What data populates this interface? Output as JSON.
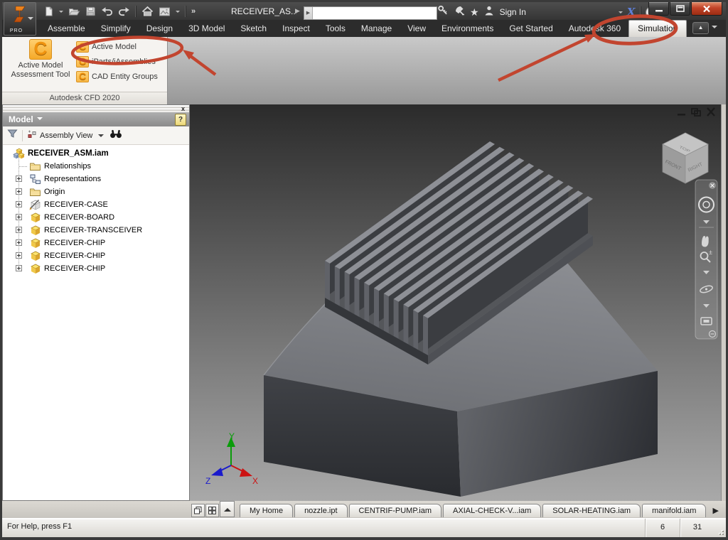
{
  "titlebar": {
    "app_badge": "PRO",
    "doc_title": "RECEIVER_AS...",
    "doc_arrow": "▶",
    "search_value": "",
    "sign_in_label": "Sign In",
    "x_logo_glyph": "X",
    "help_glyph": "?",
    "chevron_glyph": "»",
    "star_glyph": "★"
  },
  "ribbon_tabs": [
    "Assemble",
    "Simplify",
    "Design",
    "3D Model",
    "Sketch",
    "Inspect",
    "Tools",
    "Manage",
    "View",
    "Environments",
    "Get Started",
    "Autodesk 360",
    "Simulation"
  ],
  "ribbon_pill_glyph": "▲",
  "ribbon_panel": {
    "logo_glyph": "C",
    "big_button_line1": "Active Model",
    "big_button_line2": "Assessment Tool",
    "item1": "Active Model",
    "item2": "iParts/iAssemblies",
    "item3": "CAD Entity Groups",
    "footer": "Autodesk CFD 2020"
  },
  "browser": {
    "header_title": "Model",
    "view_mode": "Assembly View",
    "tree": [
      {
        "label": "RECEIVER_ASM.iam"
      },
      {
        "label": "Relationships"
      },
      {
        "label": "Representations"
      },
      {
        "label": "Origin"
      },
      {
        "label": "RECEIVER-CASE"
      },
      {
        "label": "RECEIVER-BOARD"
      },
      {
        "label": "RECEIVER-TRANSCEIVER"
      },
      {
        "label": "RECEIVER-CHIP"
      },
      {
        "label": "RECEIVER-CHIP"
      },
      {
        "label": "RECEIVER-CHIP"
      }
    ]
  },
  "viewport": {
    "viewcube_top": "TOP",
    "viewcube_front": "FRONT",
    "viewcube_right": "RIGHT",
    "axis_x": "X",
    "axis_y": "Y",
    "axis_z": "Z"
  },
  "doc_tabs": [
    "My Home",
    "nozzle.ipt",
    "CENTRIF-PUMP.iam",
    "AXIAL-CHECK-V...iam",
    "SOLAR-HEATING.iam",
    "manifold.iam"
  ],
  "doc_tabs_next_glyph": "▶",
  "statusbar": {
    "help_text": "For Help, press F1",
    "cell1": "6",
    "cell2": "31"
  },
  "colors": {
    "annotation_red": "#c2452f",
    "cfd_orange": "#f0930f",
    "inventor_orange": "#e86a10",
    "viewport_gradient_top": "#2b2b2b",
    "viewport_gradient_bottom": "#a9a9a9"
  }
}
